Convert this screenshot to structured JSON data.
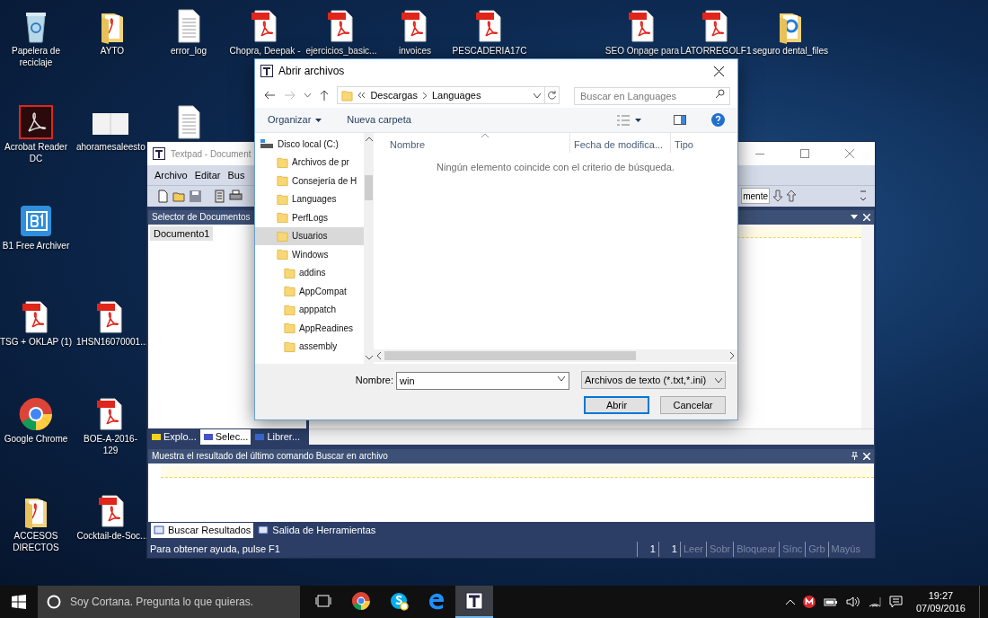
{
  "desktop": {
    "icons": [
      {
        "kind": "recycle",
        "label": "Papelera de reciclaje"
      },
      {
        "kind": "folder-pdf",
        "label": "AYTO"
      },
      {
        "kind": "text",
        "label": "error_log"
      },
      {
        "kind": "pdf",
        "label": "Chopra, Deepak -"
      },
      {
        "kind": "pdf",
        "label": "ejercicios_basic..."
      },
      {
        "kind": "pdf",
        "label": "invoices"
      },
      {
        "kind": "pdf",
        "label": "PESCADERIA17C"
      },
      {
        "kind": "pdf",
        "label": "SEO Onpage para"
      },
      {
        "kind": "pdf",
        "label": "LATORREGOLF1"
      },
      {
        "kind": "folder-edge",
        "label": "seguro dental_files"
      },
      {
        "kind": "acrobat",
        "label": "Acrobat Reader DC"
      },
      {
        "kind": "thumb",
        "label": "ahoramesaleesto"
      },
      {
        "kind": "text"
      },
      {
        "kind": "b1",
        "label": "B1 Free Archiver"
      },
      {
        "kind": "pdf",
        "label": "TSG + OKLAP (1)"
      },
      {
        "kind": "pdf",
        "label": "1HSN16070001..."
      },
      {
        "kind": "chrome",
        "label": "Google Chrome"
      },
      {
        "kind": "pdf",
        "label": "BOE-A-2016-129"
      },
      {
        "kind": "folder-pdf",
        "label": "ACCESOS DIRECTOS"
      },
      {
        "kind": "pdf",
        "label": "Cocktail-de-Soc..."
      }
    ]
  },
  "textpad": {
    "title": "Textpad - Document",
    "menu": [
      "Archivo",
      "Editar",
      "Bus"
    ],
    "toolbar_field": {
      "value": "mente"
    },
    "doc_panel": {
      "title": "Selector de Documentos",
      "documents": [
        {
          "label": "Documento1",
          "selected": true
        }
      ],
      "tabs": [
        {
          "label": "Explo...",
          "selected": false
        },
        {
          "label": "Selec...",
          "selected": true
        },
        {
          "label": "Librer...",
          "selected": false
        }
      ]
    },
    "results_panel": {
      "title": "Muestra el resultado del último comando Buscar en archivo",
      "tabs": [
        {
          "label": "Buscar Resultados",
          "selected": true
        },
        {
          "label": "Salida de Herramientas",
          "selected": false
        }
      ]
    },
    "status_bar": {
      "help": "Para obtener ayuda, pulse F1",
      "cells": [
        {
          "text": "1",
          "disabled": false
        },
        {
          "text": "1",
          "disabled": false
        },
        {
          "text": "Leer",
          "disabled": true
        },
        {
          "text": "Sobr",
          "disabled": true
        },
        {
          "text": "Bloquear",
          "disabled": true
        },
        {
          "text": "Sínc",
          "disabled": true
        },
        {
          "text": "Grb",
          "disabled": true
        },
        {
          "text": "Mayús",
          "disabled": true
        }
      ]
    }
  },
  "dialog": {
    "title": "Abrir archivos",
    "breadcrumb": [
      "Descargas",
      "Languages"
    ],
    "search": {
      "placeholder": "Buscar en Languages"
    },
    "commands": [
      "Organizar",
      "Nueva carpeta"
    ],
    "tree": [
      {
        "label": "Disco local (C:)",
        "kind": "drive",
        "selected": false,
        "children": [
          {
            "label": "Archivos de pr",
            "kind": "folder",
            "selected": false
          },
          {
            "label": "Consejería de H",
            "kind": "folder",
            "selected": false
          },
          {
            "label": "Languages",
            "kind": "folder",
            "selected": false
          },
          {
            "label": "PerfLogs",
            "kind": "folder",
            "selected": false
          },
          {
            "label": "Usuarios",
            "kind": "folder",
            "selected": true
          },
          {
            "label": "Windows",
            "kind": "folder",
            "selected": false,
            "children": [
              {
                "label": "addins",
                "kind": "folder",
                "selected": false
              },
              {
                "label": "AppCompat",
                "kind": "folder",
                "selected": false
              },
              {
                "label": "apppatch",
                "kind": "folder",
                "selected": false
              },
              {
                "label": "AppReadines",
                "kind": "folder",
                "selected": false
              },
              {
                "label": "assembly",
                "kind": "folder",
                "selected": false
              }
            ]
          }
        ]
      }
    ],
    "columns": [
      "Nombre",
      "Fecha de modifica...",
      "Tipo"
    ],
    "empty_message": "Ningún elemento coincide con el criterio de búsqueda.",
    "filename": {
      "label": "Nombre:",
      "value": "win"
    },
    "filter": {
      "value": "Archivos de texto (*.txt,*.ini)"
    },
    "buttons": [
      {
        "label": "Abrir",
        "kind": "primary"
      },
      {
        "label": "Cancelar",
        "kind": "normal"
      }
    ]
  },
  "taskbar": {
    "search": {
      "placeholder": "Soy Cortana. Pregunta lo que quieras."
    },
    "apps": [
      {
        "kind": "taskview",
        "selected": false
      },
      {
        "kind": "chrome",
        "selected": false
      },
      {
        "kind": "skype",
        "selected": false
      },
      {
        "kind": "edge",
        "selected": false
      },
      {
        "kind": "textpad",
        "selected": true
      }
    ],
    "clock": {
      "time": "19:27",
      "date": "07/09/2016"
    }
  }
}
